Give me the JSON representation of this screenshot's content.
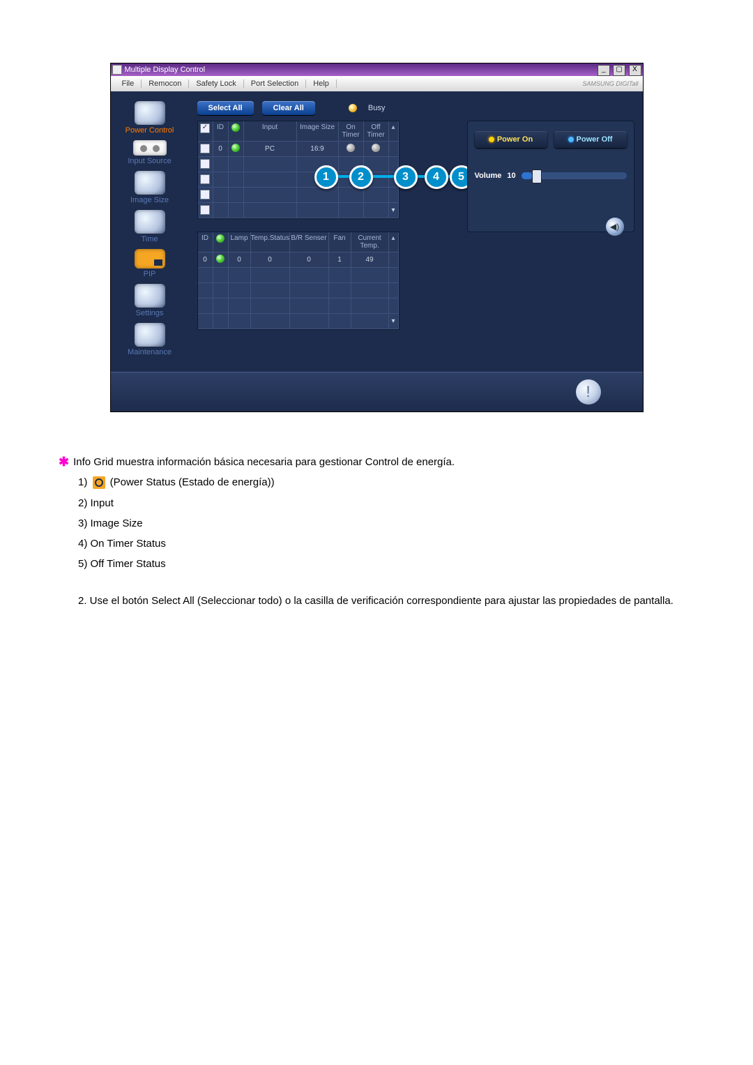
{
  "window": {
    "title": "Multiple Display Control"
  },
  "menu": {
    "file": "File",
    "remocon": "Remocon",
    "safety": "Safety Lock",
    "port": "Port Selection",
    "help": "Help",
    "brand": "SAMSUNG DIGITall"
  },
  "sidebar": {
    "power": "Power Control",
    "input": "Input Source",
    "image": "Image Size",
    "time": "Time",
    "pip": "PIP",
    "settings": "Settings",
    "maint": "Maintenance"
  },
  "toolbar": {
    "select_all": "Select All",
    "clear_all": "Clear All",
    "busy": "Busy"
  },
  "grid_top": {
    "headers": {
      "id": "ID",
      "input": "Input",
      "image": "Image Size",
      "on": "On Timer",
      "off": "Off Timer"
    },
    "row": {
      "id": "0",
      "input": "PC",
      "image": "16:9"
    }
  },
  "grid_bottom": {
    "headers": {
      "id": "ID",
      "lamp": "Lamp",
      "temp": "Temp.Status",
      "br": "B/R Senser",
      "fan": "Fan",
      "ctemp": "Current Temp."
    },
    "row": {
      "id": "0",
      "lamp": "0",
      "temp": "0",
      "br": "0",
      "fan": "1",
      "ctemp": "49"
    }
  },
  "panel": {
    "power_on": "Power On",
    "power_off": "Power Off",
    "volume_label": "Volume",
    "volume_value": "10"
  },
  "callouts": {
    "n1": "1",
    "n2": "2",
    "n3": "3",
    "n4": "4",
    "n5": "5"
  },
  "doc": {
    "intro": "Info Grid muestra información básica necesaria para gestionar Control de energía.",
    "li1a": "1) ",
    "li1b": " (Power Status (Estado de energía))",
    "li2": "2) Input",
    "li3": "3) Image Size",
    "li4": "4) On Timer Status",
    "li5": "5) Off Timer Status",
    "p2": "2.  Use el botón Select All (Seleccionar todo) o la casilla de verificación correspondiente para ajustar las propiedades de pantalla."
  }
}
